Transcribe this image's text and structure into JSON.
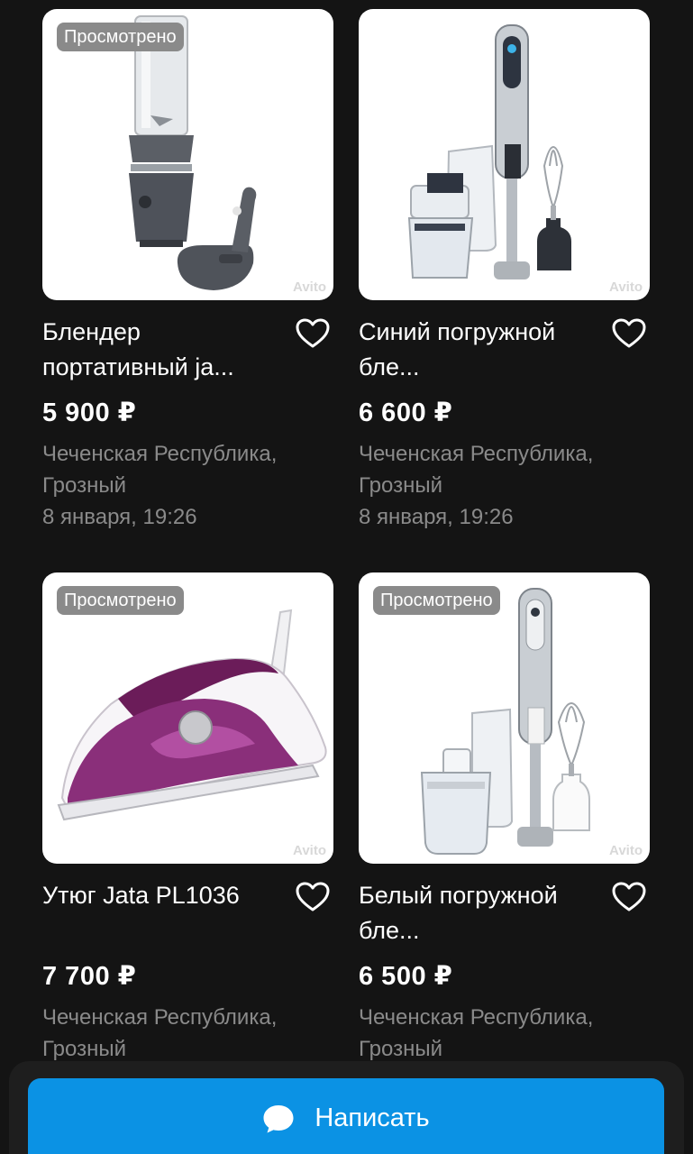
{
  "listings": [
    {
      "title": "Блендер портативный ja...",
      "price": "5 900 ₽",
      "location": "Чеченская Республика, Грозный",
      "date": "8 января, 19:26",
      "badge": "Просмотрено",
      "watermark": "Avito",
      "image": "portable-blender"
    },
    {
      "title": "Синий погружной бле...",
      "price": "6 600 ₽",
      "location": "Чеченская Республика, Грозный",
      "date": "8 января, 19:26",
      "watermark": "Avito",
      "image": "immersion-blender-blue"
    },
    {
      "title": "Утюг Jata PL1036",
      "price": "7 700 ₽",
      "location": "Чеченская Республика, Грозный",
      "badge": "Просмотрено",
      "watermark": "Avito",
      "image": "steam-iron-purple"
    },
    {
      "title": "Белый погружной бле...",
      "price": "6 500 ₽",
      "location": "Чеченская Республика, Грозный",
      "badge": "Просмотрено",
      "watermark": "Avito",
      "image": "immersion-blender-white"
    }
  ],
  "favorite_icon": "heart-outline-icon",
  "write_button": {
    "label": "Написать",
    "icon": "chat-bubble-icon",
    "color": "#0b92e4"
  },
  "colors": {
    "background": "#141414",
    "muted_text": "#8a8a8a",
    "badge": "#8a8a8a"
  }
}
